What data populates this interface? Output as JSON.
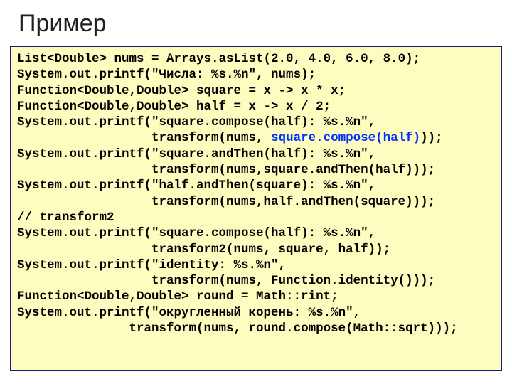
{
  "title": "Пример",
  "code": {
    "l1": "List<Double> nums = Arrays.asList(2.0, 4.0, 6.0, 8.0);",
    "l2": "System.out.printf(\"Числа: %s.%n\", nums);",
    "l3": "Function<Double,Double> square = x -> x * x;",
    "l4": "Function<Double,Double> half = x -> x / 2;",
    "l5": "System.out.printf(\"square.compose(half): %s.%n\",",
    "l6a": "                  transform(nums, ",
    "l6b": "square.compose(half)",
    "l6c": "));",
    "l7": "System.out.printf(\"square.andThen(half): %s.%n\",",
    "l8": "                  transform(nums,square.andThen(half)));",
    "l9": "System.out.printf(\"half.andThen(square): %s.%n\",",
    "l10": "                  transform(nums,half.andThen(square)));",
    "l11": "// transform2",
    "l12": "System.out.printf(\"square.compose(half): %s.%n\",",
    "l13": "                  transform2(nums, square, half));",
    "l14": "System.out.printf(\"identity: %s.%n\",",
    "l15": "                  transform(nums, Function.identity()));",
    "l16": "Function<Double,Double> round = Math::rint;",
    "l17": "System.out.printf(\"округленный корень: %s.%n\",",
    "l18": "               transform(nums, round.compose(Math::sqrt)));"
  }
}
